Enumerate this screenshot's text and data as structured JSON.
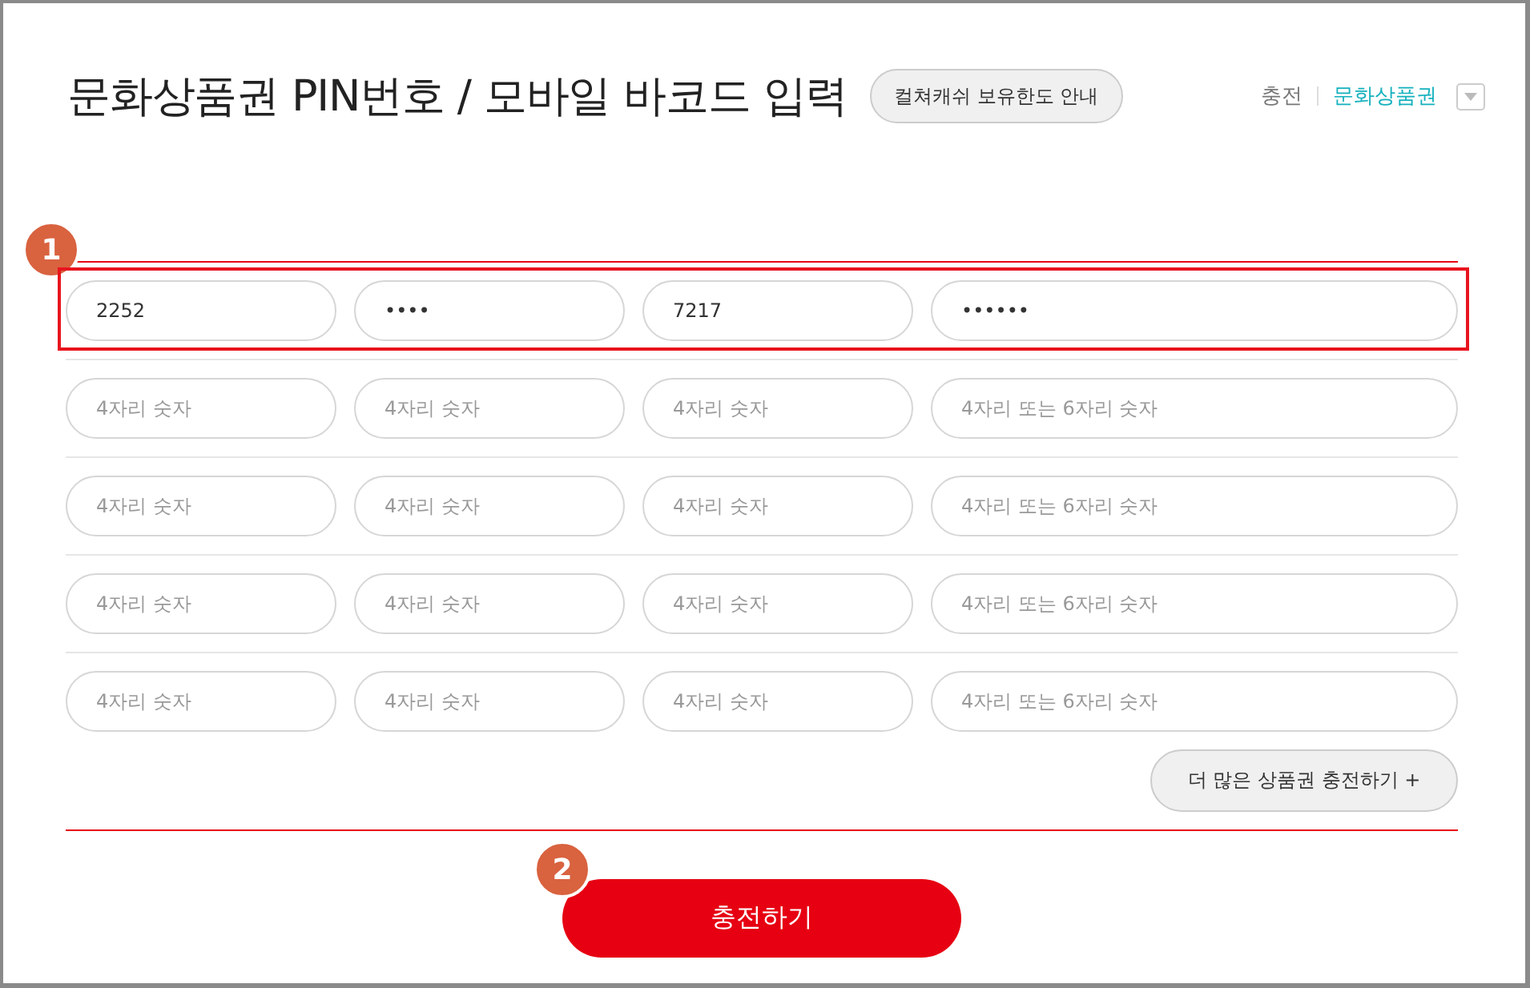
{
  "header": {
    "title": "문화상품권 PIN번호 / 모바일 바코드 입력",
    "info_button": "컬쳐캐쉬 보유한도 안내",
    "nav": [
      {
        "label": "충전",
        "selected": false
      },
      {
        "label": "문화상품권",
        "selected": true
      }
    ]
  },
  "form": {
    "step": "1",
    "rows": [
      {
        "highlighted": true,
        "fields": [
          {
            "value": "2252"
          },
          {
            "value": "••••"
          },
          {
            "value": "7217"
          },
          {
            "value": "••••••"
          }
        ]
      },
      {
        "highlighted": false,
        "fields": [
          {
            "placeholder": "4자리 숫자"
          },
          {
            "placeholder": "4자리 숫자"
          },
          {
            "placeholder": "4자리 숫자"
          },
          {
            "placeholder": "4자리 또는 6자리 숫자"
          }
        ]
      },
      {
        "highlighted": false,
        "fields": [
          {
            "placeholder": "4자리 숫자"
          },
          {
            "placeholder": "4자리 숫자"
          },
          {
            "placeholder": "4자리 숫자"
          },
          {
            "placeholder": "4자리 또는 6자리 숫자"
          }
        ]
      },
      {
        "highlighted": false,
        "fields": [
          {
            "placeholder": "4자리 숫자"
          },
          {
            "placeholder": "4자리 숫자"
          },
          {
            "placeholder": "4자리 숫자"
          },
          {
            "placeholder": "4자리 또는 6자리 숫자"
          }
        ]
      },
      {
        "highlighted": false,
        "fields": [
          {
            "placeholder": "4자리 숫자"
          },
          {
            "placeholder": "4자리 숫자"
          },
          {
            "placeholder": "4자리 숫자"
          },
          {
            "placeholder": "4자리 또는 6자리 숫자"
          }
        ]
      }
    ],
    "more_button": "더 많은 상품권 충전하기 +"
  },
  "submit": {
    "step": "2",
    "label": "충전하기"
  }
}
